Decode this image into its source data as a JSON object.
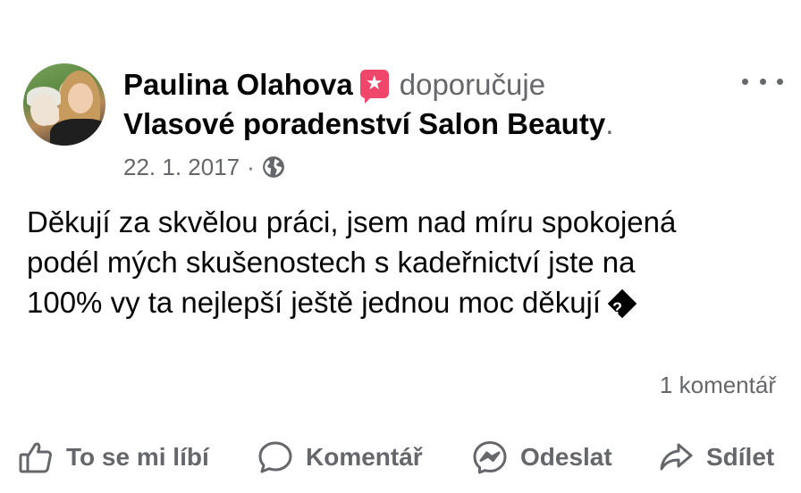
{
  "post": {
    "author": "Paulina Olahova",
    "verb": "doporučuje",
    "page": "Vlasové poradenství Salon Beauty",
    "page_suffix": ".",
    "date": "22. 1. 2017",
    "meta_sep": "·",
    "privacy_icon": "globe-icon",
    "text_lines": [
      "Děkují za skvělou práci, jsem nad míru spokojená",
      "podél mých skušenostech s kadeřnictví jste na",
      "100% vy ta nejlepší ještě jednou moc děkují"
    ],
    "comments_count": "1 komentář"
  },
  "actions": {
    "like": "To se mi líbí",
    "comment": "Komentář",
    "send": "Odeslat",
    "share": "Sdílet"
  },
  "colors": {
    "text": "#050505",
    "secondary": "#65676b",
    "recommend_badge": "#f0466b"
  }
}
